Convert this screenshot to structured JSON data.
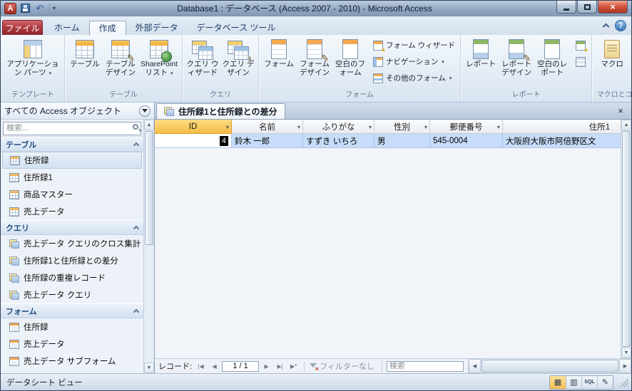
{
  "window": {
    "title": "Database1 : データベース (Access 2007 - 2010) - Microsoft Access"
  },
  "icons": {
    "app_initial": "A",
    "dropdown": "▾",
    "help": "?",
    "close": "×",
    "undo": "↶",
    "up_arrow": "▲",
    "down_arrow": "▼",
    "left_arrow": "◀",
    "right_arrow": "▶",
    "first": "|◀",
    "previous": "◀",
    "next": "▶",
    "last": "▶|",
    "new_record": "▶*",
    "pencil": "✎",
    "star": "★",
    "datasheet_view": "▦",
    "pivot_view": "▥",
    "sql_view": "SQL",
    "design_view": "✎"
  },
  "tabs": {
    "file": "ファイル",
    "items": [
      "ホーム",
      "作成",
      "外部データ",
      "データベース ツール"
    ]
  },
  "ribbon": {
    "group_names": [
      "テンプレート",
      "テーブル",
      "クエリ",
      "フォーム",
      "レポート",
      "マクロとコード"
    ],
    "buttons": {
      "app_parts": "アプリケーション パーツ",
      "table": "テーブル",
      "table_design": "テーブル デザイン",
      "sharepoint": "SharePoint リスト",
      "query_wizard": "クエリ ウィザード",
      "query_design": "クエリ デザイン",
      "form": "フォーム",
      "form_design": "フォーム デザイン",
      "blank_form": "空白のフォーム",
      "form_wizard": "フォーム ウィザード",
      "navigation": "ナビゲーション",
      "more_forms": "その他のフォーム",
      "report": "レポート",
      "report_design": "レポート デザイン",
      "blank_report": "空白のレポート",
      "macro": "マクロ"
    }
  },
  "nav_pane": {
    "title": "すべての Access オブジェクト",
    "search_placeholder": "検索...",
    "sections": [
      {
        "name": "テーブル",
        "items": [
          "住所録",
          "住所録1",
          "商品マスター",
          "売上データ"
        ]
      },
      {
        "name": "クエリ",
        "items": [
          "売上データ クエリのクロス集計",
          "住所録1と住所録との差分",
          "住所録の重複レコード",
          "売上データ クエリ"
        ]
      },
      {
        "name": "フォーム",
        "items": [
          "住所録",
          "売上データ",
          "売上データ サブフォーム"
        ]
      }
    ]
  },
  "document": {
    "tab": "住所録1と住所録との差分",
    "columns": [
      "ID",
      "名前",
      "ふりがな",
      "性別",
      "郵便番号",
      "住所1"
    ],
    "row": [
      "4",
      "鈴木 一郎",
      "すずき いちろ",
      "男",
      "545-0004",
      "大阪府大阪市阿倍野区文"
    ]
  },
  "record_nav": {
    "label": "レコード:",
    "position": "1 / 1",
    "filter": "フィルターなし",
    "search_placeholder": "検索"
  },
  "status_bar": {
    "view_label": "データシート ビュー"
  }
}
